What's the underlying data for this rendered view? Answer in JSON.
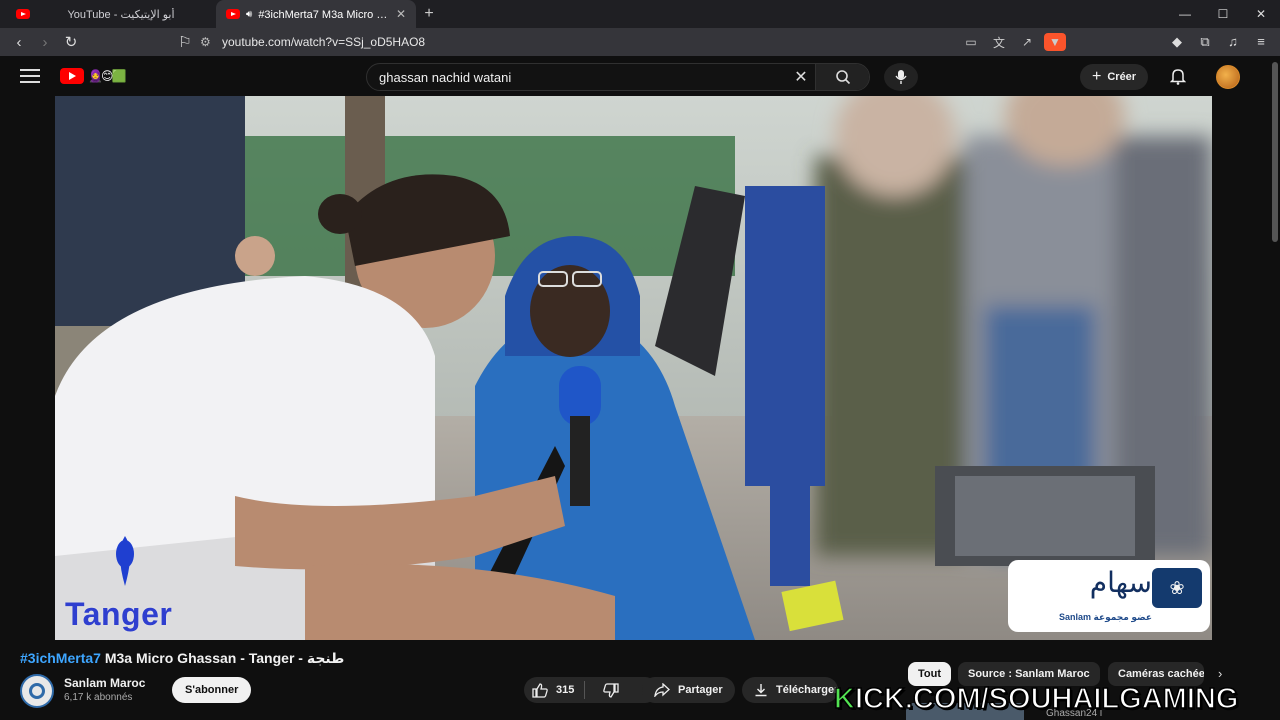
{
  "browser": {
    "tabs": [
      {
        "title": "YouTube - أبو الإيتيكيت",
        "active": false
      },
      {
        "title": "#3ichMerta7 M3a Micro Ghassan - Tanger - طنجة",
        "active": true
      }
    ],
    "url": "youtube.com/watch?v=SSj_oD5HAO8"
  },
  "youtube": {
    "search": {
      "value": "ghassan nachid watani"
    },
    "create_label": "Créer"
  },
  "video": {
    "overlay_city": "Tanger",
    "sponsor": {
      "arabic": "سهام",
      "sub": "Sanlam عضو مجموعة"
    }
  },
  "watch": {
    "title_tag": "#3ichMerta7",
    "title_rest": " M3a Micro Ghassan - Tanger - طنجة",
    "channel": {
      "name": "Sanlam Maroc",
      "subscribers": "6,17 k abonnés"
    },
    "subscribe_label": "S'abonner",
    "likes": "315",
    "share_label": "Partager",
    "download_label": "Télécharger",
    "chips": [
      "Tout",
      "Source : Sanlam Maroc",
      "Caméras cachées"
    ],
    "peek_title": "Ghassan24 l"
  },
  "watermark": {
    "first": "K",
    "rest": "ICK.COM/SOUHAILGAMING"
  },
  "colors": {
    "accent": "#3ea6ff",
    "youtube_red": "#ff0000",
    "kick_green": "#52e252"
  }
}
